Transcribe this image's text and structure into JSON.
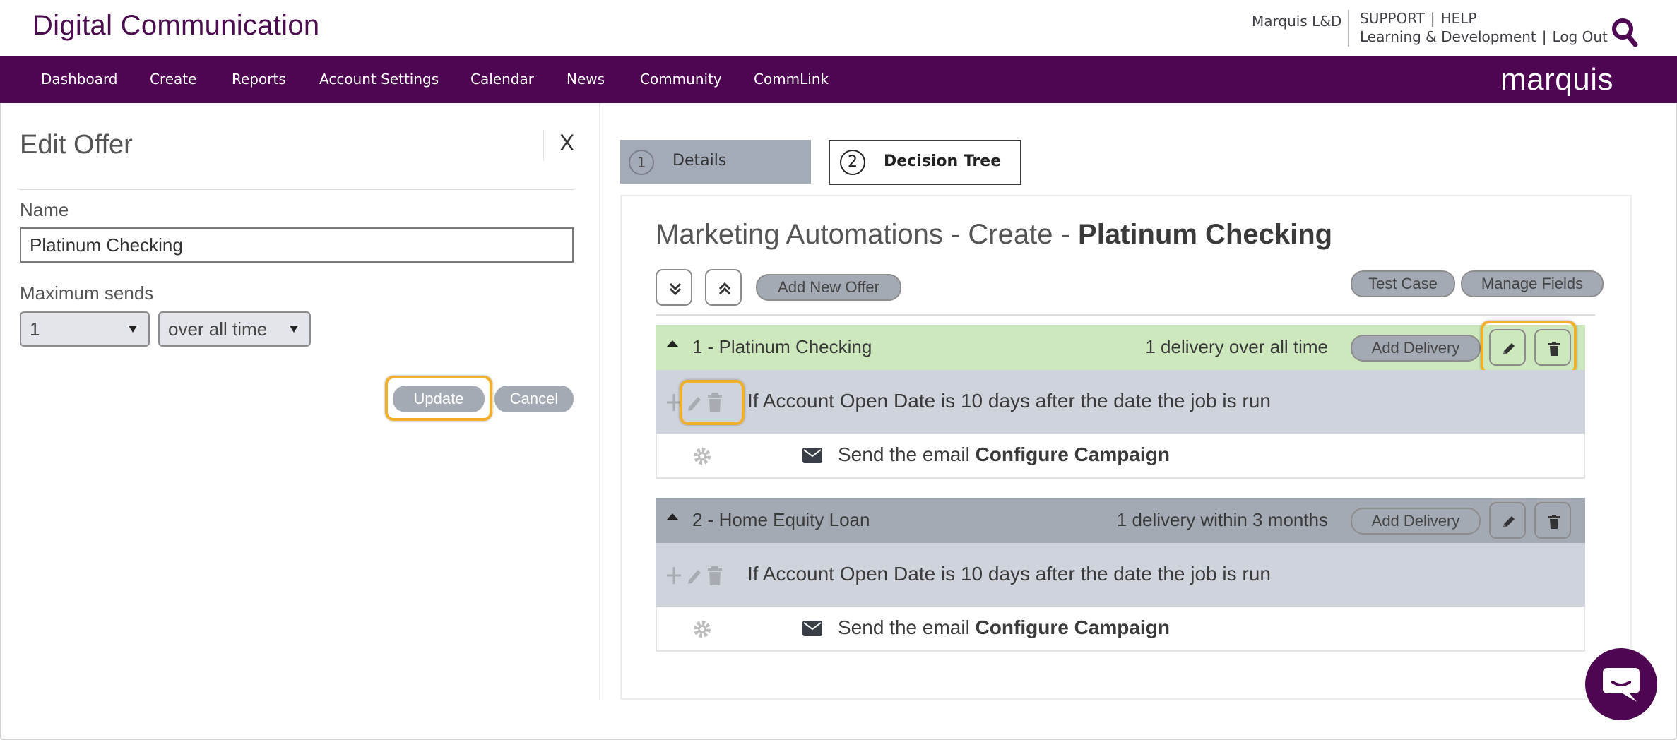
{
  "header": {
    "brand": "Digital Communication",
    "account_name": "Marquis L&D",
    "support": "SUPPORT",
    "help": "HELP",
    "learning": "Learning & Development",
    "logout": "Log Out",
    "search_icon": "search-icon"
  },
  "nav": {
    "items": [
      "Dashboard",
      "Create",
      "Reports",
      "Account Settings",
      "Calendar",
      "News",
      "Community",
      "CommLink"
    ],
    "logo": "marquis",
    "background": "#4e0552"
  },
  "edit_offer": {
    "title": "Edit Offer",
    "close_label": "X",
    "name_label": "Name",
    "name_value": "Platinum Checking",
    "max_sends_label": "Maximum sends",
    "max_sends_value": "1",
    "period_value": "over all time",
    "update_label": "Update",
    "cancel_label": "Cancel"
  },
  "tabs": [
    {
      "number": "1",
      "label": "Details"
    },
    {
      "number": "2",
      "label": "Decision Tree"
    }
  ],
  "main": {
    "title_prefix": "Marketing Automations - Create - ",
    "title_bold": "Platinum Checking",
    "add_new_offer": "Add New Offer",
    "test_case": "Test Case",
    "manage_fields": "Manage Fields"
  },
  "offers": [
    {
      "name": "1 - Platinum Checking",
      "delivery": "1 delivery over all time",
      "add_delivery": "Add Delivery",
      "condition": "If Account Open Date is 10 days after the date the job is run",
      "action_prefix": "Send the email ",
      "action_bold": "Configure Campaign"
    },
    {
      "name": "2 - Home Equity Loan",
      "delivery": "1 delivery within 3 months",
      "add_delivery": "Add Delivery",
      "condition": "If Account Open Date is 10 days after the date the job is run",
      "action_prefix": "Send the email ",
      "action_bold": "Configure Campaign"
    }
  ],
  "colors": {
    "brand_purple": "#4e0552",
    "active_offer": "#cce8bc",
    "inactive_offer": "#a4aab4",
    "highlight": "#f0b02a"
  }
}
